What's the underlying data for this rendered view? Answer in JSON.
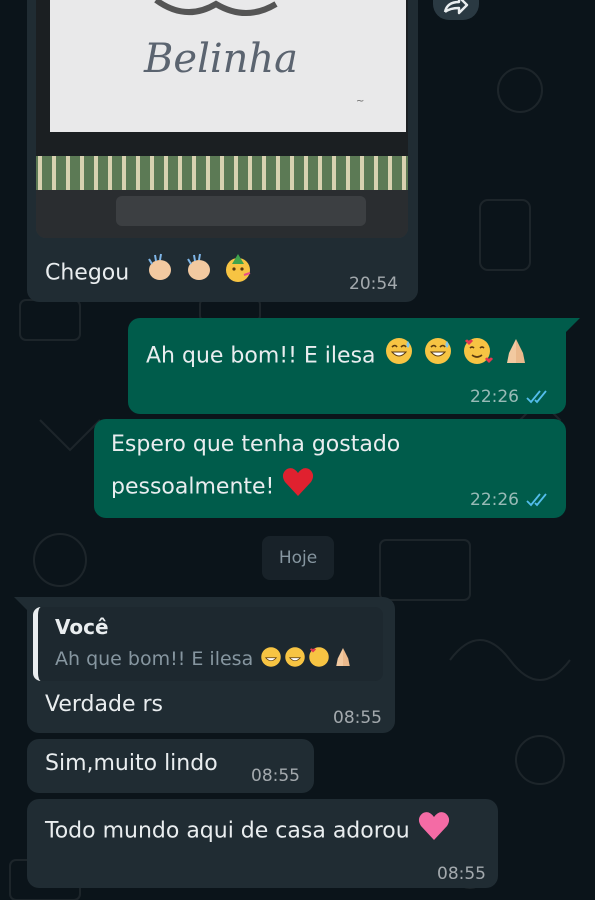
{
  "messages": [
    {
      "text": "Chegou",
      "time": "20:54",
      "emojis": [
        "clapping-hands-emoji",
        "clapping-hands-emoji",
        "partying-face-emoji"
      ]
    },
    {
      "text": "Ah que bom!! E ilesa",
      "time": "22:26",
      "emojis": [
        "grinning-sweat-emoji",
        "grinning-sweat-emoji",
        "smiling-hearts-emoji",
        "folded-hands-emoji"
      ]
    },
    {
      "line1": "Espero que tenha gostado",
      "line2": "pessoalmente!",
      "time": "22:26",
      "emojis": [
        "red-heart-emoji"
      ]
    },
    {
      "text": "Verdade rs",
      "time": "08:55",
      "quote": {
        "author": "Você",
        "text": "Ah que bom!! E ilesa"
      }
    },
    {
      "text": "Sim,muito lindo",
      "time": "08:55"
    },
    {
      "text": "Todo mundo aqui de casa adorou",
      "time": "08:55",
      "emojis": [
        "pink-heart-emoji"
      ]
    }
  ],
  "photo": {
    "caption_art": "Belinha"
  },
  "date_divider": "Hoje",
  "colors": {
    "background": "#0b141a",
    "incoming": "#202c33",
    "outgoing": "#005c4b",
    "read_ticks": "#53bdeb"
  }
}
